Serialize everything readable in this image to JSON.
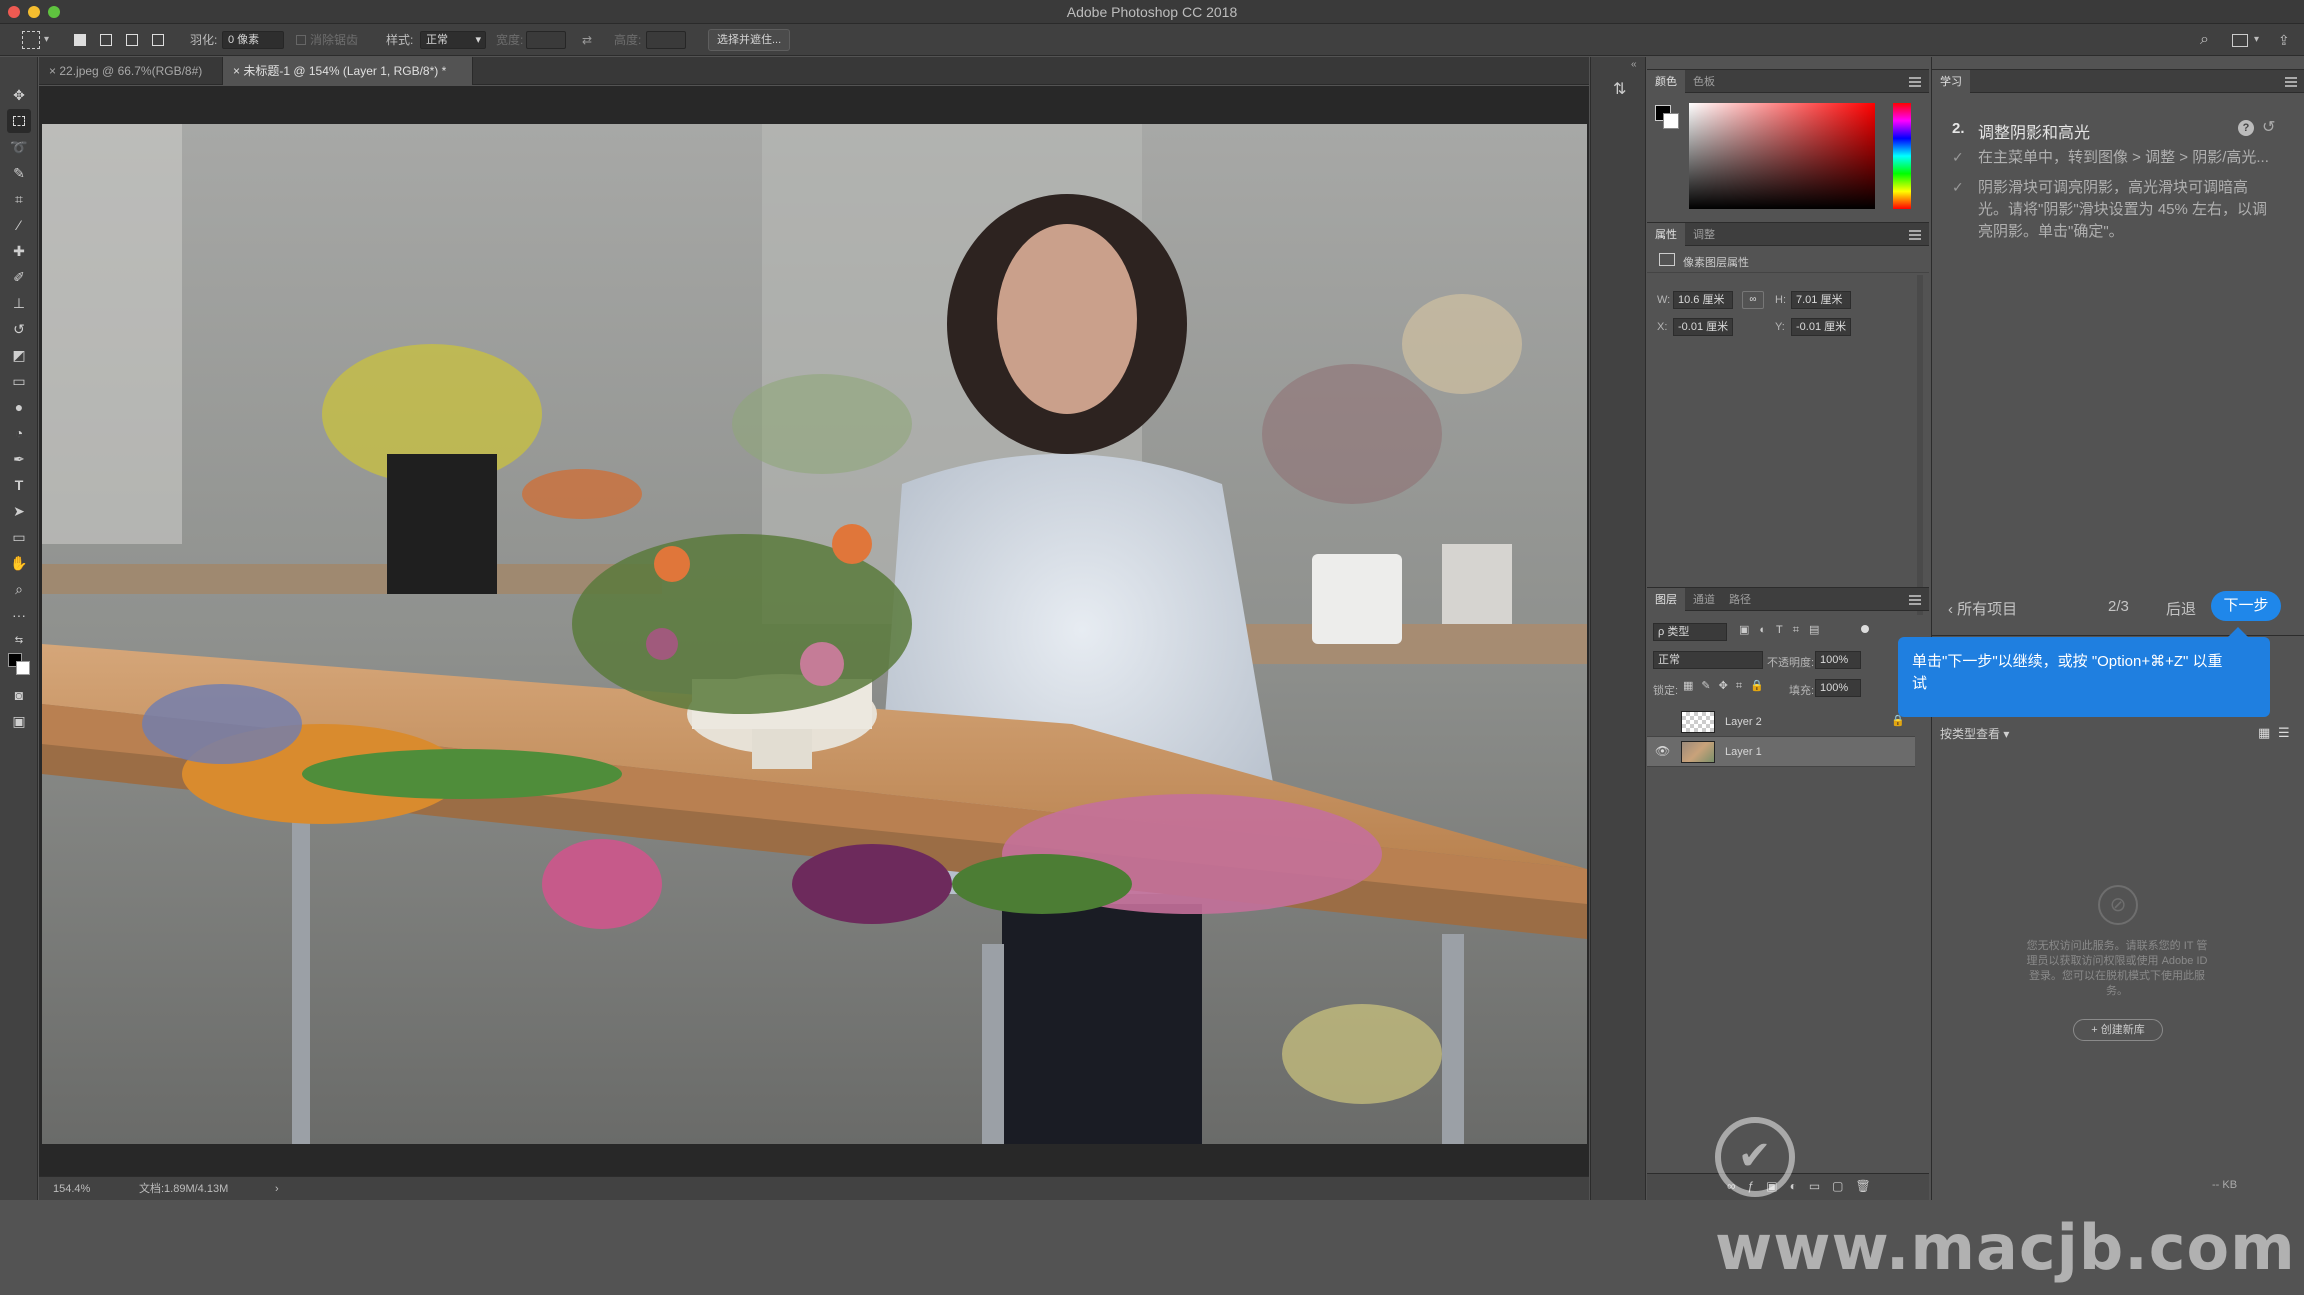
{
  "titlebar": {
    "title": "Adobe Photoshop CC 2018"
  },
  "options": {
    "feather_label": "羽化:",
    "feather_value": "0 像素",
    "antialias_label": "消除锯齿",
    "style_label": "样式:",
    "style_value": "正常",
    "width_label": "宽度:",
    "height_label": "高度:",
    "select_mask_label": "选择并遮住..."
  },
  "tabs": [
    {
      "label": "22.jpeg @ 66.7%(RGB/8#)"
    },
    {
      "label": "未标题-1 @ 154% (Layer 1, RGB/8*) *"
    }
  ],
  "status": {
    "zoom": "154.4%",
    "doc": "文档:1.89M/4.13M",
    "arrow": "›"
  },
  "color_panel": {
    "tab_color": "颜色",
    "tab_swatches": "色板"
  },
  "props_panel": {
    "tab_props": "属性",
    "tab_adjust": "调整",
    "title": "像素图层属性",
    "w_label": "W:",
    "w_value": "10.6 厘米",
    "h_label": "H:",
    "h_value": "7.01 厘米",
    "x_label": "X:",
    "x_value": "-0.01 厘米",
    "y_label": "Y:",
    "y_value": "-0.01 厘米"
  },
  "layers_panel": {
    "tab_layers": "图层",
    "tab_channels": "通道",
    "tab_paths": "路径",
    "filter": "ρ 类型",
    "blend": "正常",
    "opacity_label": "不透明度:",
    "opacity_value": "100%",
    "lock_label": "锁定:",
    "fill_label": "填充:",
    "fill_value": "100%",
    "layers": [
      {
        "name": "Layer 2"
      },
      {
        "name": "Layer 1"
      }
    ]
  },
  "learn": {
    "tab": "学习",
    "step_number": "2.",
    "step_title": "调整阴影和高光",
    "item1": "在主菜单中，转到图像 > 调整 > 阴影/高光...",
    "item2_line1": "阴影滑块可调亮阴影，高光滑块可调暗高",
    "item2_line2": "光。请将\"阴影\"滑块设置为 45% 左右，以调",
    "item2_line3": "亮阴影。单击\"确定\"。",
    "all_items": "所有项目",
    "progress": "2/3",
    "back": "后退",
    "next": "下一步",
    "tooltip_line1": "单击\"下一步\"以继续，或按 \"Option+⌘+Z\" 以重",
    "tooltip_line2": "试"
  },
  "libraries": {
    "view_by": "按类型查看",
    "msg_line1": "您无权访问此服务。请联系您的 IT 管",
    "msg_line2": "理员以获取访问权限或使用 Adobe ID",
    "msg_line3": "登录。您可以在脱机模式下使用此服",
    "msg_line4": "务。",
    "create": "+ 创建新库",
    "kb": "-- KB"
  },
  "watermark": "www.macjb.com",
  "colors": {
    "accent": "#1f7fe0",
    "panel": "#535353",
    "dark": "#3a3a3a"
  }
}
